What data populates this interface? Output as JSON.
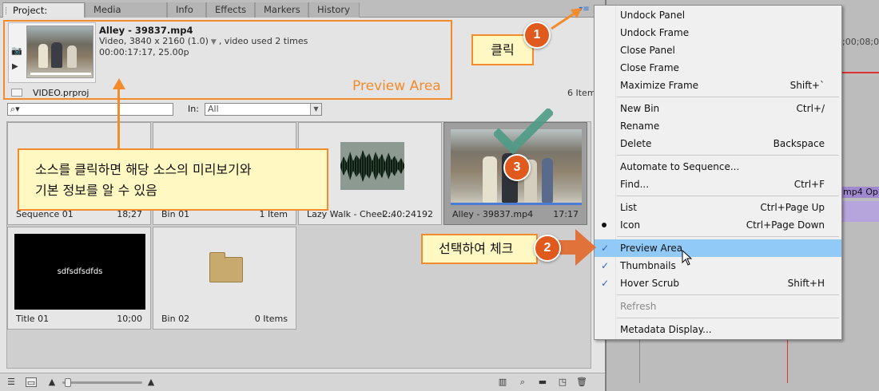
{
  "tabs": [
    {
      "label": "Project: VIDEO",
      "active": true
    },
    {
      "label": "Media Browser"
    },
    {
      "label": "Info"
    },
    {
      "label": "Effects"
    },
    {
      "label": "Markers"
    },
    {
      "label": "History"
    }
  ],
  "preview": {
    "clip_name": "Alley - 39837.mp4",
    "info_line_a": "Video, 3840 x 2160 (1.0)",
    "info_line_b": ", video used 2 times",
    "time_line": "00:00:17:17, 25.00p",
    "project_file": "VIDEO.prproj",
    "item_count": "6 Item",
    "area_label": "Preview Area"
  },
  "search": {
    "in_label": "In:",
    "in_value": "All"
  },
  "items": [
    {
      "name": "Sequence 01",
      "meta": "18;27"
    },
    {
      "name": "Bin 01",
      "meta": "1 Item"
    },
    {
      "name": "Lazy Walk - Cheel....",
      "meta": "2:40:24192"
    },
    {
      "name": "Alley - 39837.mp4",
      "meta": "17:17"
    },
    {
      "name": "Title 01",
      "meta": "10;00",
      "thumb_text": "sdfsdfsdfds"
    },
    {
      "name": "Bin 02",
      "meta": "0 Items"
    }
  ],
  "menu": {
    "items": [
      {
        "label": "Undock Panel",
        "shortcut": ""
      },
      {
        "label": "Undock Frame",
        "shortcut": ""
      },
      {
        "label": "Close Panel",
        "shortcut": ""
      },
      {
        "label": "Close Frame",
        "shortcut": ""
      },
      {
        "label": "Maximize Frame",
        "shortcut": "Shift+`"
      },
      {
        "label": "New Bin",
        "shortcut": "Ctrl+/"
      },
      {
        "label": "Rename",
        "shortcut": ""
      },
      {
        "label": "Delete",
        "shortcut": "Backspace"
      },
      {
        "label": "Automate to Sequence...",
        "shortcut": ""
      },
      {
        "label": "Find...",
        "shortcut": "Ctrl+F"
      },
      {
        "label": "List",
        "shortcut": "Ctrl+Page Up"
      },
      {
        "label": "Icon",
        "shortcut": "Ctrl+Page Down"
      },
      {
        "label": "Preview Area",
        "shortcut": ""
      },
      {
        "label": "Thumbnails",
        "shortcut": ""
      },
      {
        "label": "Hover Scrub",
        "shortcut": "Shift+H"
      },
      {
        "label": "Refresh",
        "shortcut": ""
      },
      {
        "label": "Metadata Display...",
        "shortcut": ""
      }
    ]
  },
  "right_panel": {
    "timecode": "00;00;08;0",
    "clip_label": "mp4 Op"
  },
  "annotations": {
    "main_callout_line1": "소스를 클릭하면 해당 소스의 미리보기와",
    "main_callout_line2": "기본 정보를 알 수 있음",
    "click_callout": "클릭",
    "select_callout": "선택하여 체크",
    "badge_1": "1",
    "badge_2": "2",
    "badge_3": "3"
  },
  "colors": {
    "accent_orange": "#f28b2c",
    "highlight_blue": "#91c9f7",
    "check_blue": "#2a64c4",
    "callout_fill": "#fff8c2",
    "badge_fill": "#e05a1e"
  }
}
